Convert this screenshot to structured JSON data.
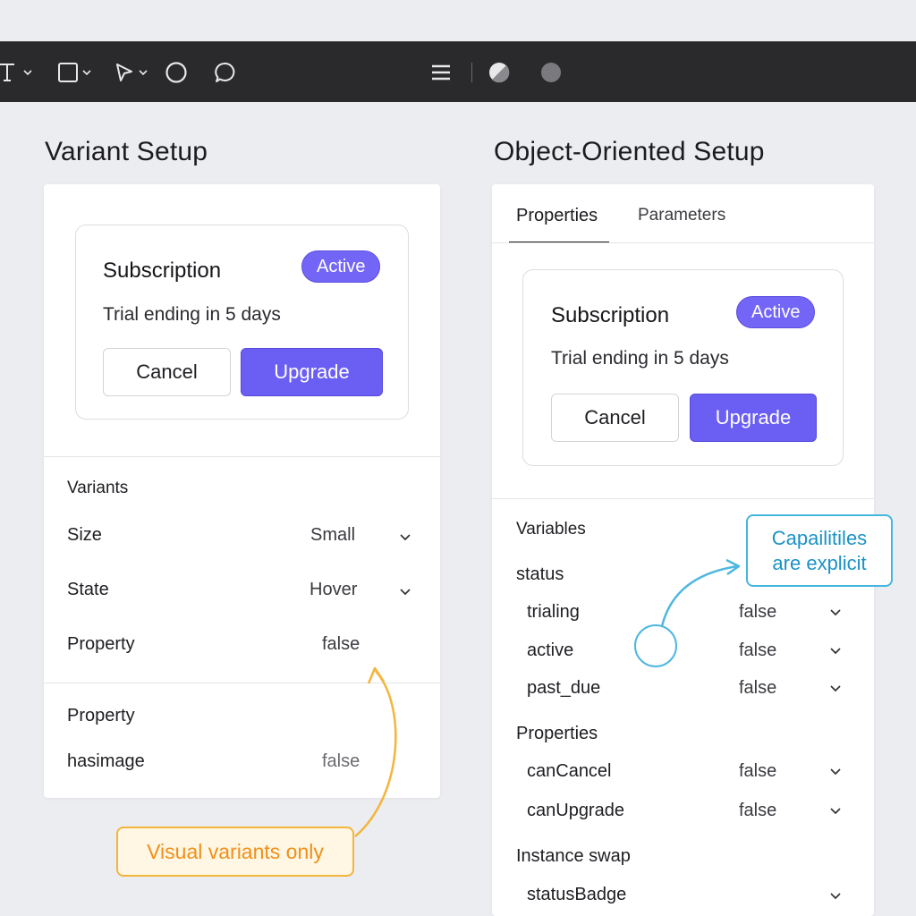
{
  "toolbar": {
    "tools": [
      "text-tool",
      "rectangle-tool",
      "pen-tool",
      "ellipse-tool",
      "comment-tool",
      "menu",
      "contrast-toggle",
      "color-swatch"
    ]
  },
  "variant": {
    "title": "Variant Setup",
    "card": {
      "title": "Subscription",
      "badge": "Active",
      "subtitle": "Trial ending in 5 days",
      "cancel": "Cancel",
      "upgrade": "Upgrade"
    },
    "variants_header": "Variants",
    "rows": [
      {
        "label": "Size",
        "value": "Small"
      },
      {
        "label": "State",
        "value": "Hover"
      },
      {
        "label": "Property",
        "value": "false"
      }
    ],
    "property_header": "Property",
    "property_row": {
      "label": "hasimage",
      "value": "false"
    }
  },
  "oo": {
    "title": "Object-Oriented Setup",
    "tabs": [
      "Properties",
      "Parameters"
    ],
    "card": {
      "title": "Subscription",
      "badge": "Active",
      "subtitle": "Trial ending in 5 days",
      "cancel": "Cancel",
      "upgrade": "Upgrade"
    },
    "variables_header": "Variables",
    "status_header": "status",
    "status_rows": [
      {
        "label": "trialing",
        "value": "false"
      },
      {
        "label": "active",
        "value": "false"
      },
      {
        "label": "past_due",
        "value": "false"
      }
    ],
    "properties_header": "Properties",
    "properties_rows": [
      {
        "label": "canCancel",
        "value": "false"
      },
      {
        "label": "canUpgrade",
        "value": "false"
      }
    ],
    "instance_header": "Instance swap",
    "instance_row": {
      "label": "statusBadge"
    }
  },
  "callouts": {
    "visual": "Visual variants only",
    "explicit_line1": "Capailitiles",
    "explicit_line2": "are explicit"
  },
  "colors": {
    "accent": "#6b5ff3",
    "orange": "#f3b53c",
    "blue": "#46b6de",
    "toolbar": "#2a2a2d"
  }
}
